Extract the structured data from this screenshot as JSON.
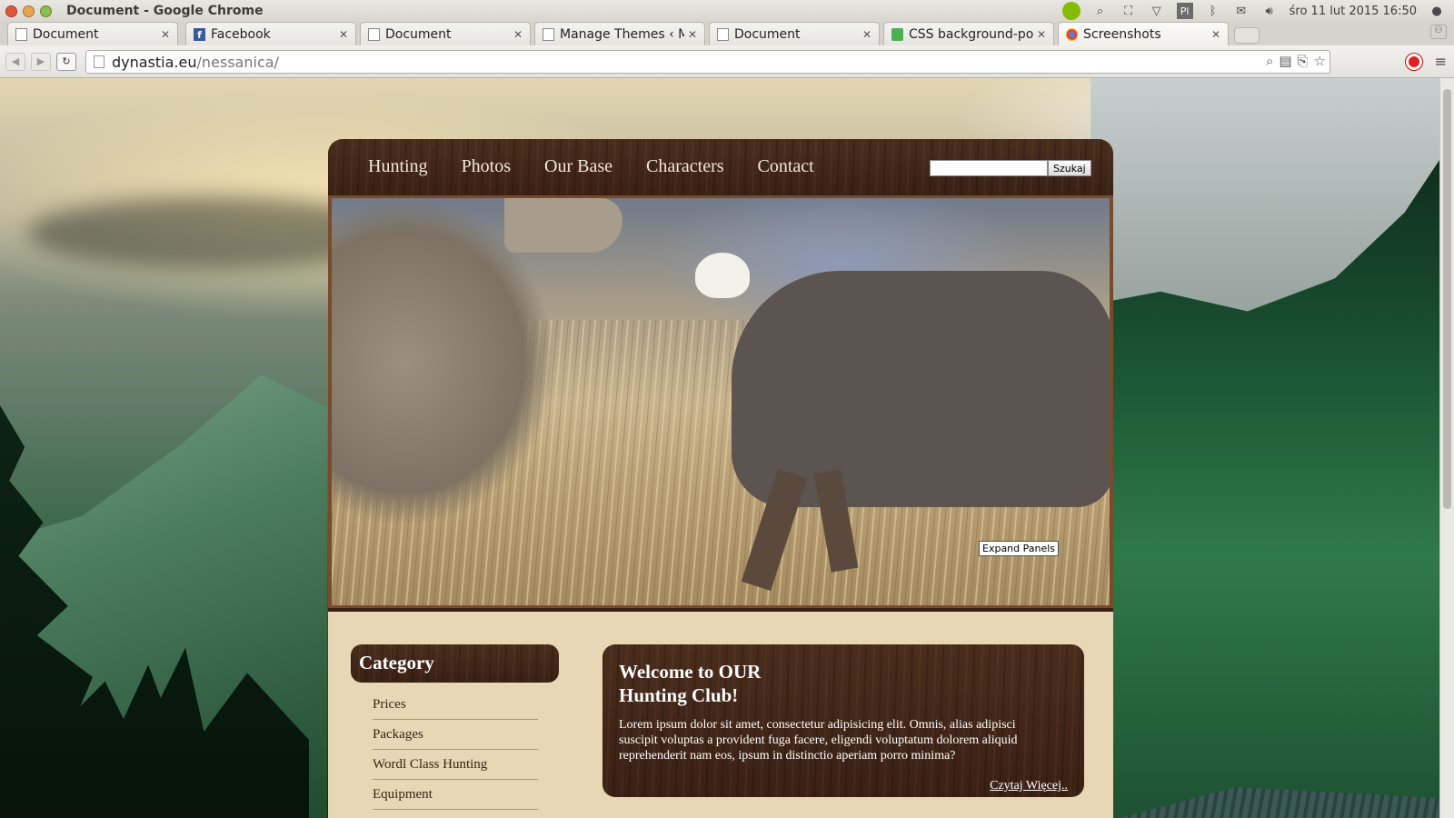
{
  "window": {
    "title": "Document - Google Chrome"
  },
  "tray": {
    "lang": "Pl",
    "datetime": "śro 11 lut 2015 16:50"
  },
  "tabs": [
    {
      "label": "Document",
      "icon": "doc"
    },
    {
      "label": "Facebook",
      "icon": "facebook"
    },
    {
      "label": "Document",
      "icon": "doc"
    },
    {
      "label": "Manage Themes ‹ M",
      "icon": "doc"
    },
    {
      "label": "Document",
      "icon": "doc"
    },
    {
      "label": "CSS background-pos",
      "icon": "css"
    },
    {
      "label": "Screenshots",
      "icon": "screenshots"
    }
  ],
  "address": {
    "domain": "dynastia.eu",
    "path": "/nessanica/"
  },
  "site": {
    "nav": [
      "Hunting",
      "Photos",
      "Our Base",
      "Characters",
      "Contact"
    ],
    "search": {
      "button": "Szukaj",
      "value": ""
    },
    "hero": {
      "expand_label": "Expand Panels"
    },
    "category": {
      "title": "Category",
      "items": [
        "Prices",
        "Packages",
        "Wordl Class Hunting",
        "Equipment"
      ]
    },
    "welcome": {
      "title_line1": "Welcome to OUR",
      "title_line2": "Hunting Club!",
      "text": "Lorem ipsum dolor sit amet, consectetur adipisicing elit. Omnis, alias adipisci suscipit voluptas a provident fuga facere, eligendi voluptatum dolorem aliquid reprehenderit nam eos, ipsum in distinctio aperiam porro minima?",
      "read_more": "Czytaj Więcej.."
    }
  }
}
